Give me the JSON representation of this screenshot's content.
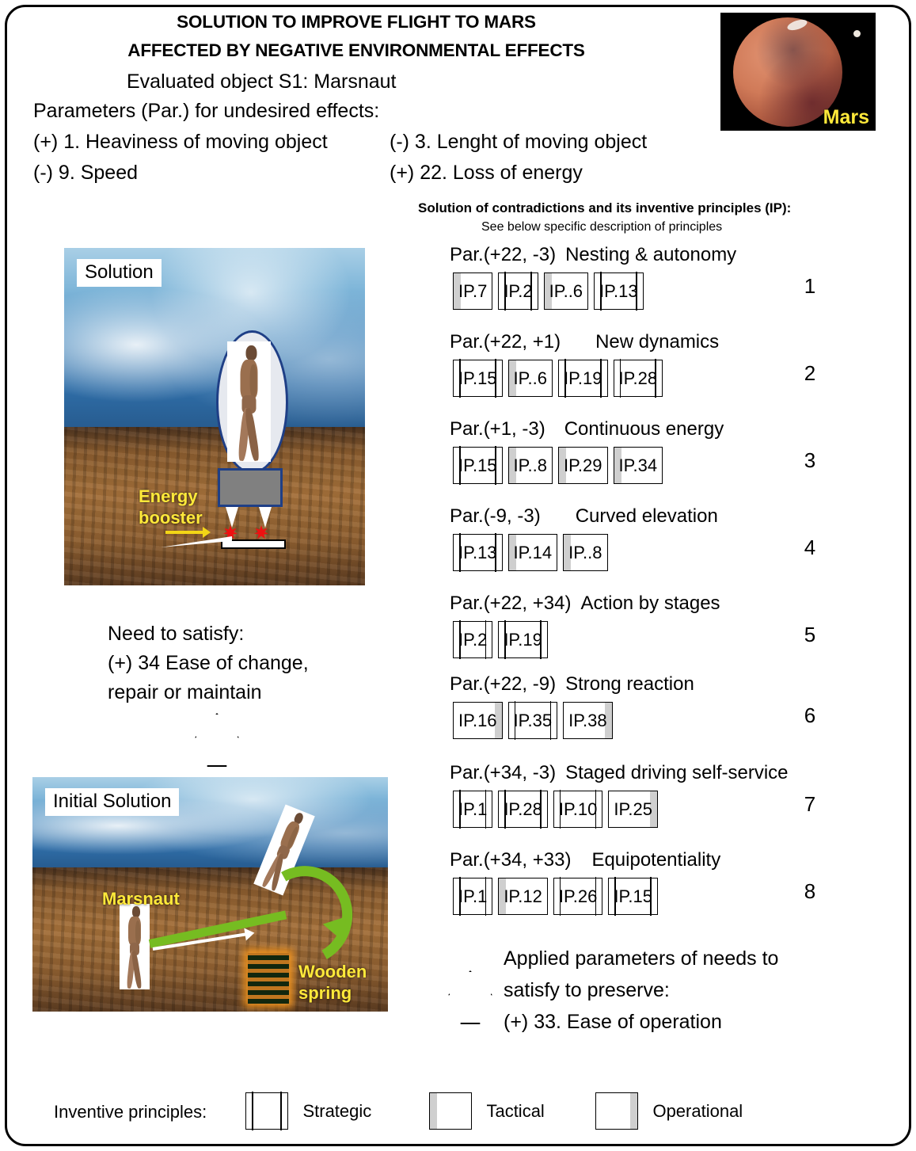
{
  "header": {
    "title_line1": "SOLUTION TO IMPROVE FLIGHT TO MARS",
    "title_line2": "AFFECTED BY NEGATIVE ENVIRONMENTAL EFFECTS",
    "subtitle": "Evaluated object S1: Marsnaut",
    "params_label": "Parameters (Par.) for undesired effects:",
    "params": [
      "(+) 1. Heaviness of moving object",
      "(-) 3. Lenght  of  moving object",
      "(-) 9.  Speed",
      "(+) 22. Loss of energy"
    ],
    "mars_label": "Mars"
  },
  "right_panel": {
    "heading": "Solution of contradictions and its inventive principles (IP):",
    "subheading": "See below specific description of principles",
    "rows": [
      {
        "par": "Par.(+22, -3)",
        "name": "Nesting & autonomy",
        "index": "1",
        "ips": [
          {
            "label": "IP.7",
            "kind": "tactical"
          },
          {
            "label": "IP.2",
            "kind": "strategic"
          },
          {
            "label": "IP..6",
            "kind": "tactical"
          },
          {
            "label": "IP.13",
            "kind": "strategic"
          }
        ]
      },
      {
        "par": "Par.(+22, +1)",
        "name": "New dynamics",
        "index": "2",
        "ips": [
          {
            "label": "IP.15",
            "kind": "strategic"
          },
          {
            "label": "IP..6",
            "kind": "tactical"
          },
          {
            "label": "IP.19",
            "kind": "strategic"
          },
          {
            "label": "IP.28",
            "kind": "strategic"
          }
        ]
      },
      {
        "par": "Par.(+1, -3)",
        "name": "Continuous energy",
        "index": "3",
        "ips": [
          {
            "label": "IP.15",
            "kind": "strategic"
          },
          {
            "label": "IP..8",
            "kind": "tactical"
          },
          {
            "label": "IP.29",
            "kind": "tactical"
          },
          {
            "label": "IP.34",
            "kind": "tactical"
          }
        ]
      },
      {
        "par": "Par.(-9, -3)",
        "name": "Curved elevation",
        "index": "4",
        "ips": [
          {
            "label": "IP.13",
            "kind": "strategic"
          },
          {
            "label": "IP.14",
            "kind": "tactical"
          },
          {
            "label": "IP..8",
            "kind": "tactical"
          }
        ]
      },
      {
        "par": "Par.(+22, +34)",
        "name": "Action by stages",
        "index": "5",
        "ips": [
          {
            "label": "IP.2",
            "kind": "strategic"
          },
          {
            "label": "IP.19",
            "kind": "strategic"
          }
        ]
      },
      {
        "par": "Par.(+22, -9)",
        "name": "Strong reaction",
        "index": "6",
        "ips": [
          {
            "label": "IP.16",
            "kind": "operational"
          },
          {
            "label": "IP.35",
            "kind": "strategic"
          },
          {
            "label": "IP.38",
            "kind": "operational"
          }
        ]
      },
      {
        "par": "Par.(+34, -3)",
        "name": "Staged driving self-service",
        "index": "7",
        "ips": [
          {
            "label": "IP.1",
            "kind": "strategic"
          },
          {
            "label": "IP.28",
            "kind": "strategic"
          },
          {
            "label": "IP.10",
            "kind": "strategic"
          },
          {
            "label": "IP.25",
            "kind": "operational"
          }
        ]
      },
      {
        "par": "Par.(+34, +33)",
        "name": "Equipotentiality",
        "index": "8",
        "ips": [
          {
            "label": "IP.1",
            "kind": "strategic"
          },
          {
            "label": "IP.12",
            "kind": "tactical"
          },
          {
            "label": "IP.26",
            "kind": "strategic"
          },
          {
            "label": "IP.15",
            "kind": "strategic"
          }
        ]
      }
    ],
    "applied_text": "Applied parameters of needs to satisfy to preserve:\n(+) 33. Ease of operation"
  },
  "solution_image": {
    "tag": "Solution",
    "energy_booster_label": "Energy\nbooster"
  },
  "initial_image": {
    "tag": "Initial Solution",
    "marsnaut_label": "Marsnaut",
    "wooden_spring_label": "Wooden\nspring"
  },
  "need_text": "Need to satisfy:\n(+) 34 Ease of change,\nrepair or maintain",
  "legend": {
    "label": "Inventive principles:",
    "items": [
      {
        "kind": "strategic",
        "text": "Strategic"
      },
      {
        "kind": "tactical",
        "text": "Tactical"
      },
      {
        "kind": "operational",
        "text": "Operational"
      }
    ]
  },
  "colors": {
    "yellow_label": "#ffe93a",
    "green_arrow": "#76bc21",
    "capsule_blue": "#1f3f86",
    "gray_marker": "#cfcfcf"
  }
}
